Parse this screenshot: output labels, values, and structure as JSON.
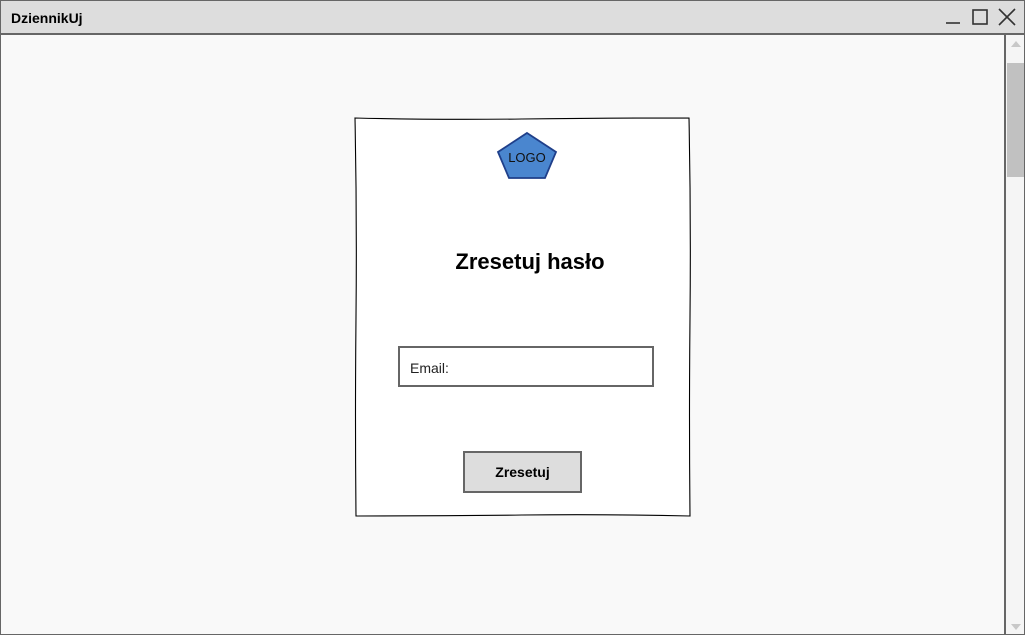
{
  "window": {
    "title": "DziennikUj",
    "controls": {
      "minimize_icon": "minimize-icon",
      "maximize_icon": "maximize-icon",
      "close_icon": "close-icon"
    }
  },
  "card": {
    "logo_text": "LOGO",
    "title": "Zresetuj hasło",
    "email_label": "Email:",
    "submit_label": "Zresetuj"
  },
  "colors": {
    "titlebar_bg": "#dddddd",
    "window_bg": "#f9f9f9",
    "border": "#666666",
    "logo_fill": "#4a86cf",
    "logo_stroke": "#1f3f8a",
    "button_bg": "#dddddd",
    "scroll_thumb": "#c1c1c1"
  }
}
